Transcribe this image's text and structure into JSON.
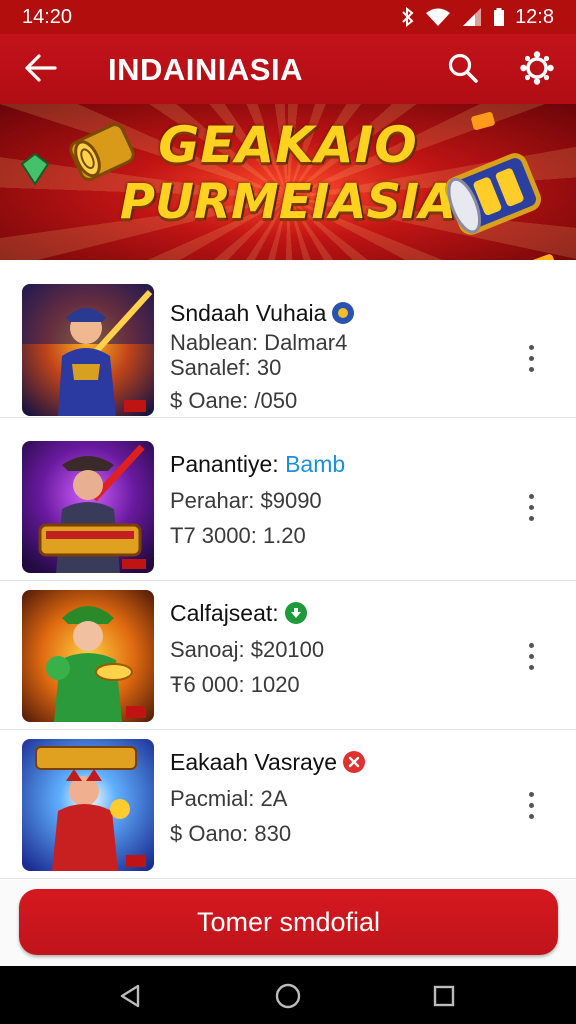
{
  "status_bar": {
    "time": "14:20",
    "clock_right": "12:8",
    "icons": [
      "bluetooth-icon",
      "wifi-icon",
      "signal-icon",
      "battery-icon"
    ]
  },
  "app_bar": {
    "title": "INDAINIASIA",
    "back_icon": "arrow-left-icon",
    "search_icon": "search-icon",
    "settings_icon": "settings-icon"
  },
  "banner": {
    "line1": "GEAKAIO",
    "line2": "PURMEIASIA"
  },
  "items": [
    {
      "title": "Sndaah Vuhaia",
      "badge": "blue",
      "line2": "Nablean: Dalmar4",
      "line3": "Sanalef: 30",
      "line4": "$ Oane: /050"
    },
    {
      "title": "Panantiye:",
      "title_accent": "Bamb",
      "line2": "Perahar: $9090",
      "line3": "T7 3000: 1.20"
    },
    {
      "title": "Calfajseat:",
      "badge": "green",
      "line2": "Sanoaj: $20100",
      "line3": "Ŧ6 000: 1020"
    },
    {
      "title": "Eakaah Vasraye",
      "badge": "red",
      "line2": "Pacmial: 2A",
      "line3": "$ Oano: 830"
    }
  ],
  "cta": {
    "label": "Tomer smdofial"
  },
  "colors": {
    "primary": "#c4121a",
    "accent_blue": "#1a8fe0"
  }
}
